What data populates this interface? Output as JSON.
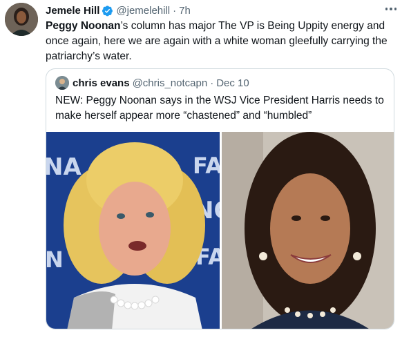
{
  "tweet": {
    "author_name": "Jemele Hill",
    "handle": "@jemelehill",
    "separator": "·",
    "time": "7h",
    "text_bold": "Peggy Noonan",
    "text_rest": "’s column has major The VP is Being Uppity energy and once again, here we are again with a white woman gleefully carrying the patriarchy’s water.",
    "more_icon": "more-horizontal-icon",
    "verified_color": "#1d9bf0"
  },
  "quoted_tweet": {
    "author_name": "chris evans",
    "handle": "@chris_notcapn",
    "separator": "·",
    "date": "Dec 10",
    "text": "NEW: Peggy Noonan says in the WSJ Vice President Harris needs to make herself appear more “chastened” and “humbled”",
    "images": [
      {
        "name": "peggy-noonan-photo",
        "background_letters": [
          "NA",
          "FA",
          "NO",
          "FA",
          "N"
        ]
      },
      {
        "name": "kamala-harris-photo"
      }
    ]
  }
}
